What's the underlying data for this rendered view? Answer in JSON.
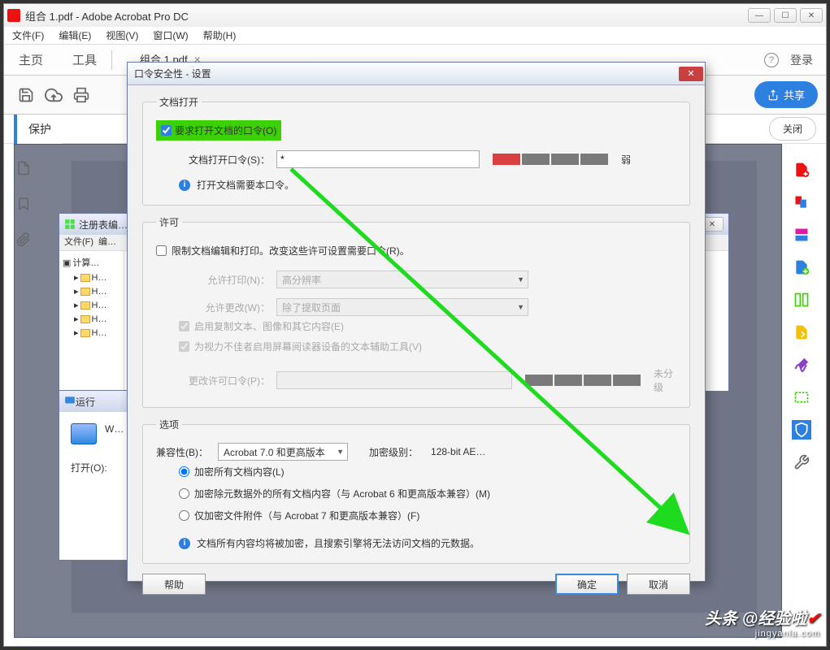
{
  "window": {
    "title": "组合 1.pdf - Adobe Acrobat Pro DC"
  },
  "menu": {
    "file": "文件(F)",
    "edit": "编辑(E)",
    "view": "视图(V)",
    "window": "窗口(W)",
    "help": "帮助(H)"
  },
  "toolbar": {
    "home": "主页",
    "tools": "工具",
    "tab_label": "组合 1.pdf",
    "login": "登录",
    "share": "共享"
  },
  "protectbar": {
    "label": "保护",
    "close": "关闭"
  },
  "regwin": {
    "title": "注册表编…",
    "menu_file": "文件(F)",
    "menu_edit": "编…",
    "root": "计算…",
    "node": "H…"
  },
  "runwin": {
    "title": "运行",
    "desc": "W…",
    "open_label": "打开(O):"
  },
  "dialog": {
    "title": "口令安全性 - 设置",
    "section_open": "文档打开",
    "require_pwd": "要求打开文档的口令(O)",
    "open_pwd_label": "文档打开口令(S)：",
    "open_pwd_value": "*",
    "strength_label": "弱",
    "open_info": "打开文档需要本口令。",
    "section_perm": "许可",
    "restrict_edit": "限制文档编辑和打印。改变这些许可设置需要口令(R)。",
    "allow_print_label": "允许打印(N)：",
    "allow_print_value": "高分辨率",
    "allow_change_label": "允许更改(W)：",
    "allow_change_value": "除了提取页面",
    "enable_copy": "启用复制文本、图像和其它内容(E)",
    "enable_reader": "为视力不佳者启用屏幕阅读器设备的文本辅助工具(V)",
    "change_perm_pwd_label": "更改许可口令(P)：",
    "perm_strength_label": "未分级",
    "section_options": "选项",
    "compat_label": "兼容性(B)：",
    "compat_value": "Acrobat 7.0 和更高版本",
    "enc_level_label": "加密级别：",
    "enc_level_value": "128-bit AE…",
    "opt_encrypt_all": "加密所有文档内容(L)",
    "opt_encrypt_except_meta": "加密除元数据外的所有文档内容（与 Acrobat 6 和更高版本兼容）(M)",
    "opt_attachments_only": "仅加密文件附件（与 Acrobat 7 和更高版本兼容）(F)",
    "opt_info": "文档所有内容均将被加密，且搜索引擎将无法访问文档的元数据。",
    "btn_help": "帮助",
    "btn_ok": "确定",
    "btn_cancel": "取消"
  },
  "watermark": {
    "main": "头条 @经验啦",
    "sub": "jingyanla.com"
  }
}
